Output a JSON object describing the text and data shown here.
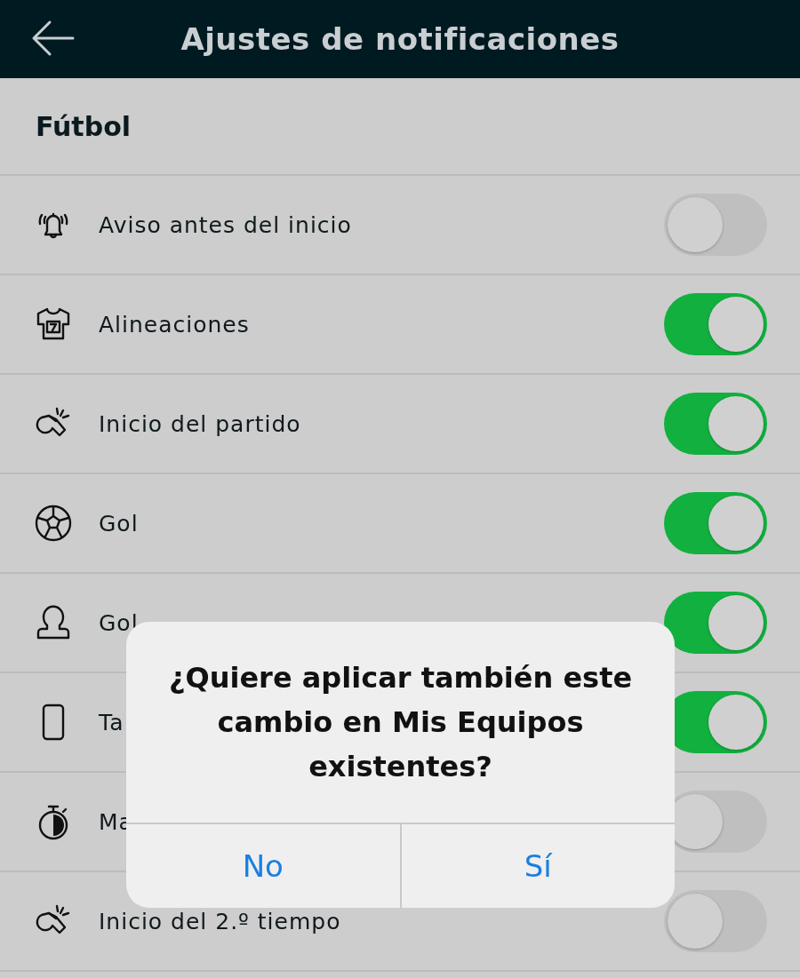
{
  "header": {
    "title": "Ajustes de notificaciones"
  },
  "section": {
    "title": "Fútbol"
  },
  "rows": [
    {
      "label": "Aviso antes del inicio",
      "kind": "bell",
      "on": false
    },
    {
      "label": "Alineaciones",
      "kind": "shirt",
      "on": true
    },
    {
      "label": "Inicio del partido",
      "kind": "whistle",
      "on": true
    },
    {
      "label": "Gol",
      "kind": "ball",
      "on": true
    },
    {
      "label": "Gol",
      "kind": "person",
      "on": true
    },
    {
      "label": "Ta",
      "kind": "card",
      "on": true
    },
    {
      "label": "Ma",
      "kind": "stopwatch",
      "on": false
    },
    {
      "label": "Inicio del 2.º tiempo",
      "kind": "whistle",
      "on": false
    }
  ],
  "dialog": {
    "message": "¿Quiere aplicar también este cambio en Mis Equipos existentes?",
    "buttons": [
      "No",
      "Sí"
    ]
  }
}
